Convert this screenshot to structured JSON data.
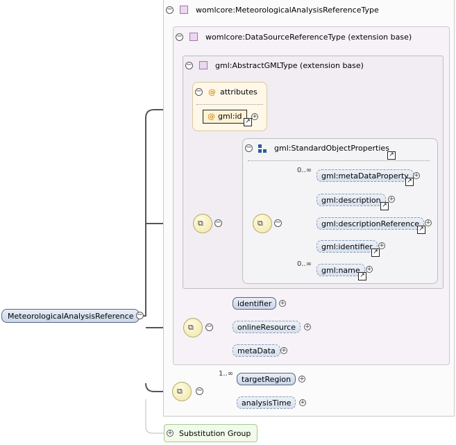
{
  "containers": {
    "complex_type_label": "womlcore:MeteorologicalAnalysisReferenceType",
    "extension_label": "womlcore:DataSourceReferenceType (extension base)",
    "gml_abstract_label": "gml:AbstractGMLType (extension base)",
    "attributes_label": "attributes",
    "gml_id_label": "gml:id",
    "std_props_label": "gml:StandardObjectProperties"
  },
  "root_element": "MeteorologicalAnalysisReference",
  "std_props_items": [
    {
      "label": "gml:metaDataProperty",
      "occurrence": "0..∞"
    },
    {
      "label": "gml:description",
      "occurrence": ""
    },
    {
      "label": "gml:descriptionReference",
      "occurrence": ""
    },
    {
      "label": "gml:identifier",
      "occurrence": ""
    },
    {
      "label": "gml:name",
      "occurrence": "0..∞"
    }
  ],
  "datasource_items": [
    "identifier",
    "onlineResource",
    "metaData"
  ],
  "analysis_items": [
    {
      "label": "targetRegion",
      "occurrence": "1..∞"
    },
    {
      "label": "analysisTime",
      "occurrence": ""
    }
  ],
  "substitution_group_label": "Substitution Group"
}
